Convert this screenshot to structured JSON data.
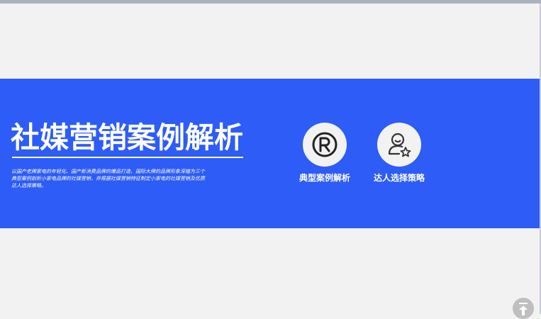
{
  "banner": {
    "title": "社媒营销案例解析",
    "description": "以国产老牌家电的年轻化、国产新消费品牌的爆品打造、国际大牌的品牌形象深植为三个典型案例剖析小家电品牌的社媒营销，并根据社媒营销特征制定小家电的社媒营销及优质达人选择策略。",
    "features": [
      {
        "label": "典型案例解析",
        "icon": "registered-trademark-icon"
      },
      {
        "label": "达人选择策略",
        "icon": "person-star-icon"
      }
    ]
  },
  "scroll_top": {
    "icon": "scroll-to-top-icon"
  },
  "colors": {
    "banner": "#2d5cf6",
    "background": "#f2f2f2"
  }
}
